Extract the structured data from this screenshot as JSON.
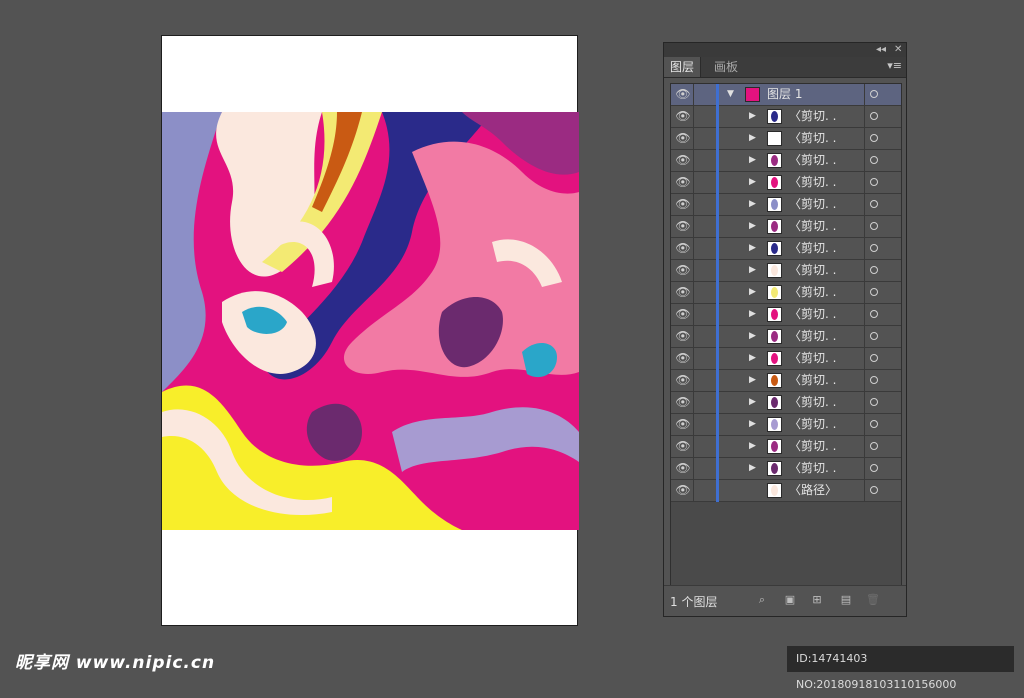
{
  "panel": {
    "collapse_icon": "double-chevron-left-icon",
    "close_icon": "close-icon",
    "tabs": [
      {
        "label": "图层",
        "active": true
      },
      {
        "label": "画板",
        "active": false
      }
    ],
    "menu_icon": "panel-menu-icon",
    "top_layer": {
      "name": "图层 1",
      "expanded": true
    },
    "items": [
      {
        "name": "〈剪切. ."
      },
      {
        "name": "〈剪切. ."
      },
      {
        "name": "〈剪切. ."
      },
      {
        "name": "〈剪切. ."
      },
      {
        "name": "〈剪切. ."
      },
      {
        "name": "〈剪切. ."
      },
      {
        "name": "〈剪切. ."
      },
      {
        "name": "〈剪切. ."
      },
      {
        "name": "〈剪切. ."
      },
      {
        "name": "〈剪切. ."
      },
      {
        "name": "〈剪切. ."
      },
      {
        "name": "〈剪切. ."
      },
      {
        "name": "〈剪切. ."
      },
      {
        "name": "〈剪切. ."
      },
      {
        "name": "〈剪切. ."
      },
      {
        "name": "〈剪切. ."
      },
      {
        "name": "〈剪切. ."
      },
      {
        "name": "〈路径〉",
        "is_path": true
      }
    ],
    "footer": {
      "layer_count": "1 个图层",
      "buttons": [
        "locate-object-icon",
        "make-clipping-mask-icon",
        "create-sublayer-icon",
        "new-layer-icon",
        "trash-icon"
      ]
    }
  },
  "watermark": {
    "logo": "昵享网 www.nipic.cn",
    "id_text": "ID:14741403 NO:20180918103110156000"
  },
  "colors": {
    "background": "#535353",
    "selection_highlight": "#5d6480",
    "layer_color_bar": "#3f6fd1"
  }
}
